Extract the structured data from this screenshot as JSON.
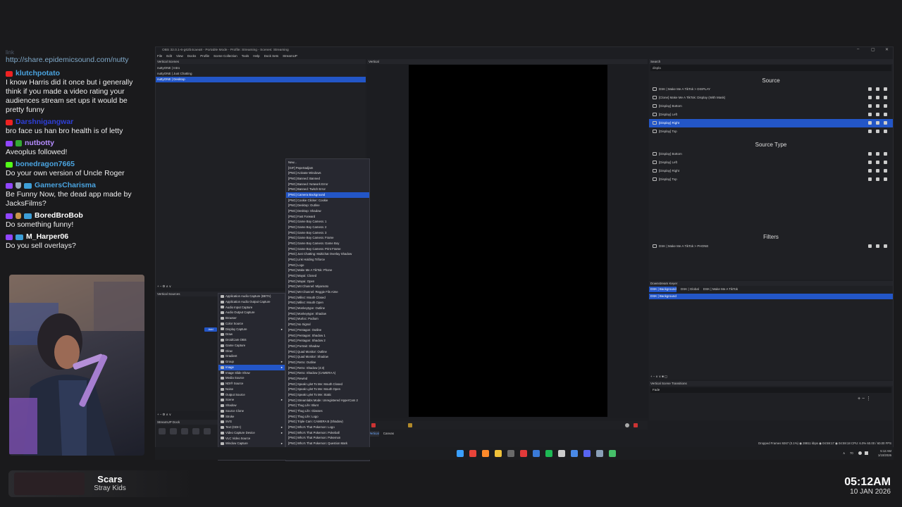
{
  "chat": {
    "faded_label": "link",
    "link": "http://share.epidemicsound.com/nutty",
    "messages": [
      {
        "user": "klutchpotato",
        "user_color": "#4aa3df",
        "badges": [
          "youtube"
        ],
        "text": "I know Harris did it once but i generally think if you made a video rating your audiences stream set ups it would be pretty funny"
      },
      {
        "user": "Darshnigangwar",
        "user_color": "#2e3fd8",
        "badges": [
          "youtube"
        ],
        "text": "bro face us han bro health is of letty"
      },
      {
        "user": "nutbotty",
        "user_color": "#b58cff",
        "badges": [
          "twitch",
          "verified"
        ],
        "text": "Aveoplus followed!"
      },
      {
        "user": "bonedragon7665",
        "user_color": "#4aa3df",
        "badges": [
          "kick"
        ],
        "text": "Do your own version of Uncle Roger"
      },
      {
        "user": "GamersCharisma",
        "user_color": "#4aa3df",
        "badges": [
          "twitch",
          "shield",
          "prime"
        ],
        "text": "Be Funny Now, the dead app made by JacksFilms?"
      },
      {
        "user": "BoredBroBob",
        "user_color": "#ffffff",
        "badges": [
          "twitch",
          "cup",
          "prime"
        ],
        "text": "Do something funny!"
      },
      {
        "user": "M_Harper06",
        "user_color": "#ffffff",
        "badges": [
          "twitch",
          "prime"
        ],
        "text": "Do you sell overlays?"
      }
    ]
  },
  "now_playing": {
    "title": "Scars",
    "artist": "Stray Kids"
  },
  "clock": {
    "time": "05:12AM",
    "date": "10 JAN 2026"
  },
  "obs": {
    "title": "OBS 32.0.1-6-g62b4caea8 - Portable Mode - Profile: Streaming - Scenes: Streaming",
    "menu": [
      "File",
      "Edit",
      "View",
      "Docks",
      "Profile",
      "Scene Collection",
      "Tools",
      "Help",
      "Dock Sets",
      "StreamUP"
    ],
    "window_controls": [
      "–",
      "▢",
      "✕"
    ],
    "scenes": {
      "header": "Vertical Scenes",
      "items": [
        "nuttyONE | Intro",
        "nuttyONE | Just Chatting",
        "nuttyONE | Desktop"
      ],
      "selected": 2
    },
    "preview_header": "Vertical",
    "sources_header": "Vertical Sources",
    "add_label": "Add",
    "streamup_dock": "StreamUP Dock",
    "source_types": [
      {
        "label": "Application Audio Capture (BETA)",
        "icon": "audio-icon"
      },
      {
        "label": "Application Audio Output Capture",
        "icon": "audio-icon"
      },
      {
        "label": "Audio Input Capture",
        "icon": "mic-icon"
      },
      {
        "label": "Audio Output Capture",
        "icon": "speaker-icon"
      },
      {
        "label": "Browser",
        "icon": "globe-icon"
      },
      {
        "label": "Color Source",
        "icon": "palette-icon"
      },
      {
        "label": "Display Capture",
        "icon": "monitor-icon",
        "arrow": true
      },
      {
        "label": "Draw",
        "icon": "pen-icon"
      },
      {
        "label": "DroidCam OBS",
        "icon": "camera-icon"
      },
      {
        "label": "Game Capture",
        "icon": "gamepad-icon"
      },
      {
        "label": "Glow",
        "icon": "glow-icon"
      },
      {
        "label": "Gradient",
        "icon": "gradient-icon"
      },
      {
        "label": "Group",
        "icon": "folder-icon",
        "arrow": true
      },
      {
        "label": "Image",
        "icon": "image-icon",
        "arrow": true,
        "selected": true
      },
      {
        "label": "Image Slide Show",
        "icon": "slideshow-icon"
      },
      {
        "label": "Media Source",
        "icon": "media-icon"
      },
      {
        "label": "NDI® Source",
        "icon": "ndi-icon"
      },
      {
        "label": "Noise",
        "icon": "noise-icon"
      },
      {
        "label": "Output Source",
        "icon": "output-icon"
      },
      {
        "label": "Scene",
        "icon": "scene-icon",
        "arrow": true
      },
      {
        "label": "Shadow",
        "icon": "shadow-icon"
      },
      {
        "label": "Source Clone",
        "icon": "clone-icon"
      },
      {
        "label": "Stroke",
        "icon": "stroke-icon"
      },
      {
        "label": "SVG",
        "icon": "svg-icon"
      },
      {
        "label": "Text (GDI+)",
        "icon": "text-icon",
        "arrow": true
      },
      {
        "label": "Video Capture Device",
        "icon": "camera-icon",
        "arrow": true
      },
      {
        "label": "VLC Video Source",
        "icon": "vlc-icon"
      },
      {
        "label": "Window Capture",
        "icon": "window-icon",
        "arrow": true
      },
      {
        "label": "Deprecated",
        "icon": "none",
        "arrow": true
      }
    ],
    "image_submenu": [
      "New...",
      "[GIF] PepeSadjam",
      "[PNG] Activate Windows",
      "[PNG] Banned: Banned",
      "[PNG] Banned: Network Error",
      "[PNG] Banned: Twitch Error",
      "[PNG] Camera Background",
      "[PNG] Cookie Clicker: Cookie",
      "[PNG] Desktop: Outline",
      "[PNG] Desktop: Shadow",
      "[PNG] Fast Forward",
      "[PNG] Game Boy Camera: 1",
      "[PNG] Game Boy Camera: 2",
      "[PNG] Game Boy Camera: 3",
      "[PNG] Game Boy Camera: Frame",
      "[PNG] Game Boy Camera: Game Boy",
      "[PNG] Game Boy Camera: Print Frame",
      "[PNG] Just Chatting: Multichat Overlay Shadow",
      "[PNG] Link Holding Triforce",
      "[PNG] Logo",
      "[PNG] Make Me A TikTok: Phone",
      "[PNG] Mayai: Closed",
      "[PNG] Mayai: Open",
      "[PNG] MII Channel: Miyamoto",
      "[PNG] MII Channel: Reggie Fils Aime",
      "[PNG] Millez: Mouth Closed",
      "[PNG] Millez: Mouth Open",
      "[PNG] Monkeytype: Outline",
      "[PNG] Monkeytype: Shadow",
      "[PNG] Murloc: Podium",
      "[PNG] No Signal",
      "[PNG] Pentagon: Outline",
      "[PNG] Pentagon: Shadow 1",
      "[PNG] Pentagon: Shadow 2",
      "[PNG] Portrait: Shadow",
      "[PNG] Quad Monitor: Outline",
      "[PNG] Quad Monitor: Shadow",
      "[PNG] Retro: Outline",
      "[PNG] Retro: Shadow (4:3)",
      "[PNG] Retro: Shadow (CAMERA A)",
      "[PNG] Rewind",
      "[PNG] Speak Lylet To Me: Mouth Closed",
      "[PNG] Speak Lylet To Me: Mouth Open",
      "[PNG] Speak Lylet To Me: Static",
      "[PNG] Streamlabs Mode: Unregistered HyperCam 2",
      "[PNG] Thug Life: Blunt",
      "[PNG] Thug Life: Glasses",
      "[PNG] Thug Life: Logo",
      "[PNG] Triple Cam: CAMERA B (Shadow)",
      "[PNG] Who's That Pokemon: Logo",
      "[PNG] Who's That Pokemon: Pokeball",
      "[PNG] Who's That Pokemon: Pokemon",
      "[PNG] Who's That Pokemon: Question Mark",
      "sj2276skrnek9.gif",
      "Image"
    ],
    "image_submenu_selected": 6,
    "search": {
      "header": "Search",
      "query": "displa",
      "source_section": "Source",
      "source_results": [
        "DSK | Make Me A TikTok > DISPLAY",
        "[Clone] Make Me A TikTok: Display (With Mask)",
        "[Display] Bottom",
        "[Display] Left",
        "[Display] Right",
        "[Display] Top"
      ],
      "source_selected": 4,
      "type_section": "Source Type",
      "type_results": [
        "[Display] Bottom",
        "[Display] Left",
        "[Display] Right",
        "[Display] Top"
      ],
      "filters_section": "Filters",
      "filter_results": [
        "DSK | Make Me A TikTok > PHONE"
      ]
    },
    "dsk": {
      "header": "Downstream Keyer",
      "tabs": [
        "DSK | Background",
        "DSK | Global",
        "DSK | Make Me A TikTok"
      ],
      "selected_tab": 0,
      "items": [
        "DSK | Background"
      ]
    },
    "transitions": {
      "header": "Vertical Scene Transitions",
      "value": "Fade"
    },
    "canvas_tabs": [
      "Vertical",
      "Canvas"
    ],
    "status": "Dropped Frames 9267 (0.1%)   ◉ 28811 kbps   ◉ 04:59:17   ◉ 04:59:18   CPU: 6.0%  60.00 / 60.00 FPS"
  },
  "taskbar": {
    "time": "5:12 AM",
    "date": "1/10/2026",
    "tray_temp": "70",
    "icons": [
      {
        "name": "windows-start-icon",
        "color": "#3aa0ff"
      },
      {
        "name": "chrome-icon",
        "color": "#e9443a"
      },
      {
        "name": "firefox-icon",
        "color": "#ff8a2a"
      },
      {
        "name": "file-explorer-icon",
        "color": "#f0c23a"
      },
      {
        "name": "obs-icon",
        "color": "#6a6a6a"
      },
      {
        "name": "record-app-icon",
        "color": "#e23a3a"
      },
      {
        "name": "streamdeck-icon",
        "color": "#3a7ad8"
      },
      {
        "name": "spotify-icon",
        "color": "#1db954"
      },
      {
        "name": "pen-app-icon",
        "color": "#cccccc"
      },
      {
        "name": "shield-app-icon",
        "color": "#4a8ae8"
      },
      {
        "name": "discord-icon",
        "color": "#5865f2"
      },
      {
        "name": "network-app-icon",
        "color": "#8aa0b8"
      },
      {
        "name": "notepad-icon",
        "color": "#46c06a"
      }
    ]
  }
}
